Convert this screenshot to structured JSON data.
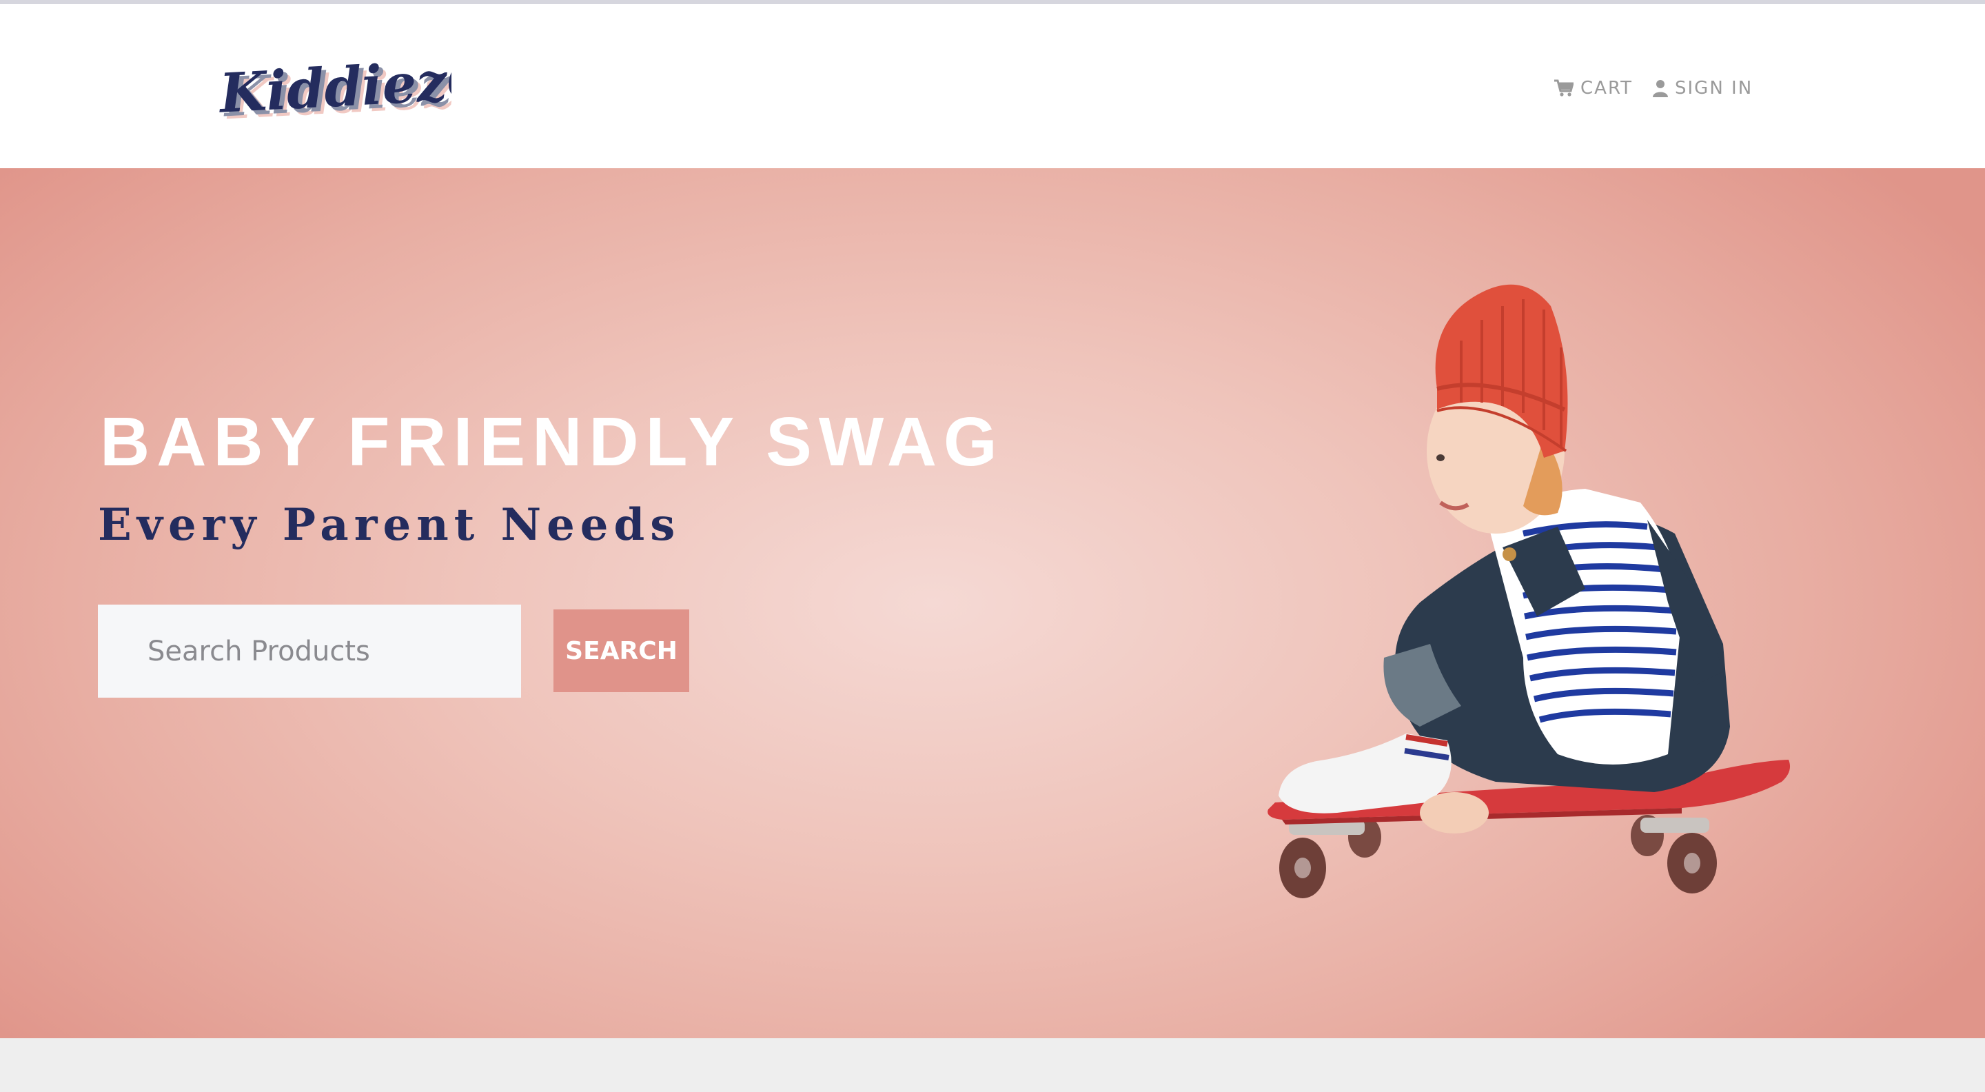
{
  "brand": {
    "logo_text": "KiddiezGo"
  },
  "nav": {
    "cart_label": "CART",
    "cart_icon": "shopping-cart-icon",
    "signin_label": "SIGN IN",
    "signin_icon": "user-icon"
  },
  "hero": {
    "title": "BABY FRIENDLY SWAG",
    "subtitle": "Every Parent Needs",
    "search": {
      "placeholder": "Search Products",
      "value": ""
    },
    "search_button_label": "SEARCH",
    "image": "child-on-skateboard"
  },
  "colors": {
    "accent": "#e0938a",
    "navy": "#242c5e",
    "hero_center": "#f5d9d4",
    "hero_edge": "#e0958a"
  }
}
